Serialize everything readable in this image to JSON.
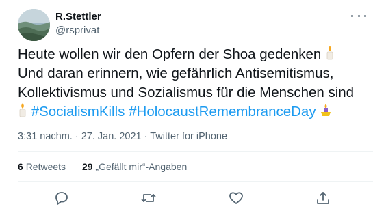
{
  "author": {
    "display_name": "R.Stettler",
    "handle": "@rsprivat"
  },
  "tweet": {
    "line1": "Heute wollen wir den Opfern der Shoa gedenken",
    "line2": "Und daran erinnern, wie gefährlich Antisemitismus,",
    "line3": "Kollektivismus und Sozialismus für die Menschen sind",
    "hashtag1": "#SocialismKills",
    "hashtag2": "#HolocaustRemembranceDay"
  },
  "meta": {
    "time": "3:31 nachm.",
    "separator": " · ",
    "date": "27. Jan. 2021",
    "source": "Twitter for iPhone"
  },
  "stats": {
    "retweets_count": "6",
    "retweets_label": "Retweets",
    "likes_count": "29",
    "likes_label": "„Gefällt mir“-Angaben"
  },
  "colors": {
    "link": "#1d9bf0",
    "secondary_text": "#536471",
    "divider": "#eff3f4"
  },
  "icons": [
    "more-icon",
    "candle-icon",
    "menorah-icon",
    "reply-icon",
    "retweet-icon",
    "like-icon",
    "share-icon"
  ]
}
